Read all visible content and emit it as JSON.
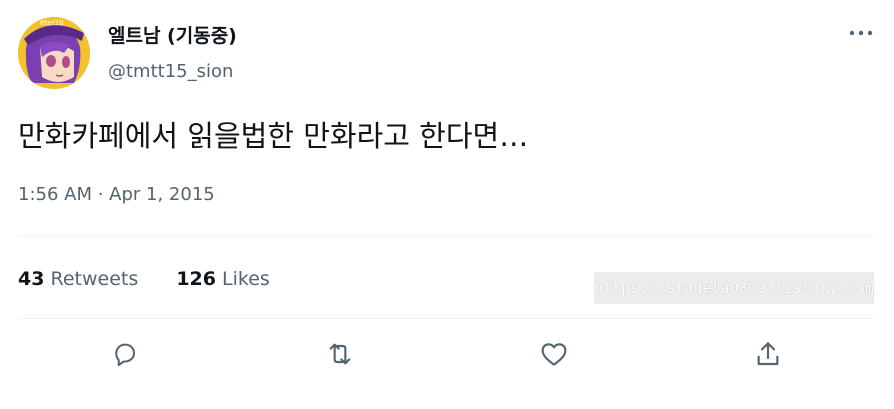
{
  "author": {
    "display_name": "엘트남 (기동중)",
    "handle": "@tmtt15_sion",
    "avatar_icon": "user-avatar"
  },
  "tweet": {
    "text": "만화카페에서 읽을법한 만화라고 한다면…",
    "timestamp": "1:56 AM · Apr 1, 2015"
  },
  "stats": {
    "retweets_count": "43",
    "retweets_label": "Retweets",
    "likes_count": "126",
    "likes_label": "Likes"
  },
  "watermark": "https://stadela0309.tistory.com",
  "actions": [
    {
      "name": "reply",
      "icon": "reply-icon"
    },
    {
      "name": "retweet",
      "icon": "retweet-icon"
    },
    {
      "name": "like",
      "icon": "heart-icon"
    },
    {
      "name": "share",
      "icon": "share-icon"
    }
  ],
  "colors": {
    "text_primary": "#0f1419",
    "text_secondary": "#536471",
    "divider": "#eff3f4"
  }
}
